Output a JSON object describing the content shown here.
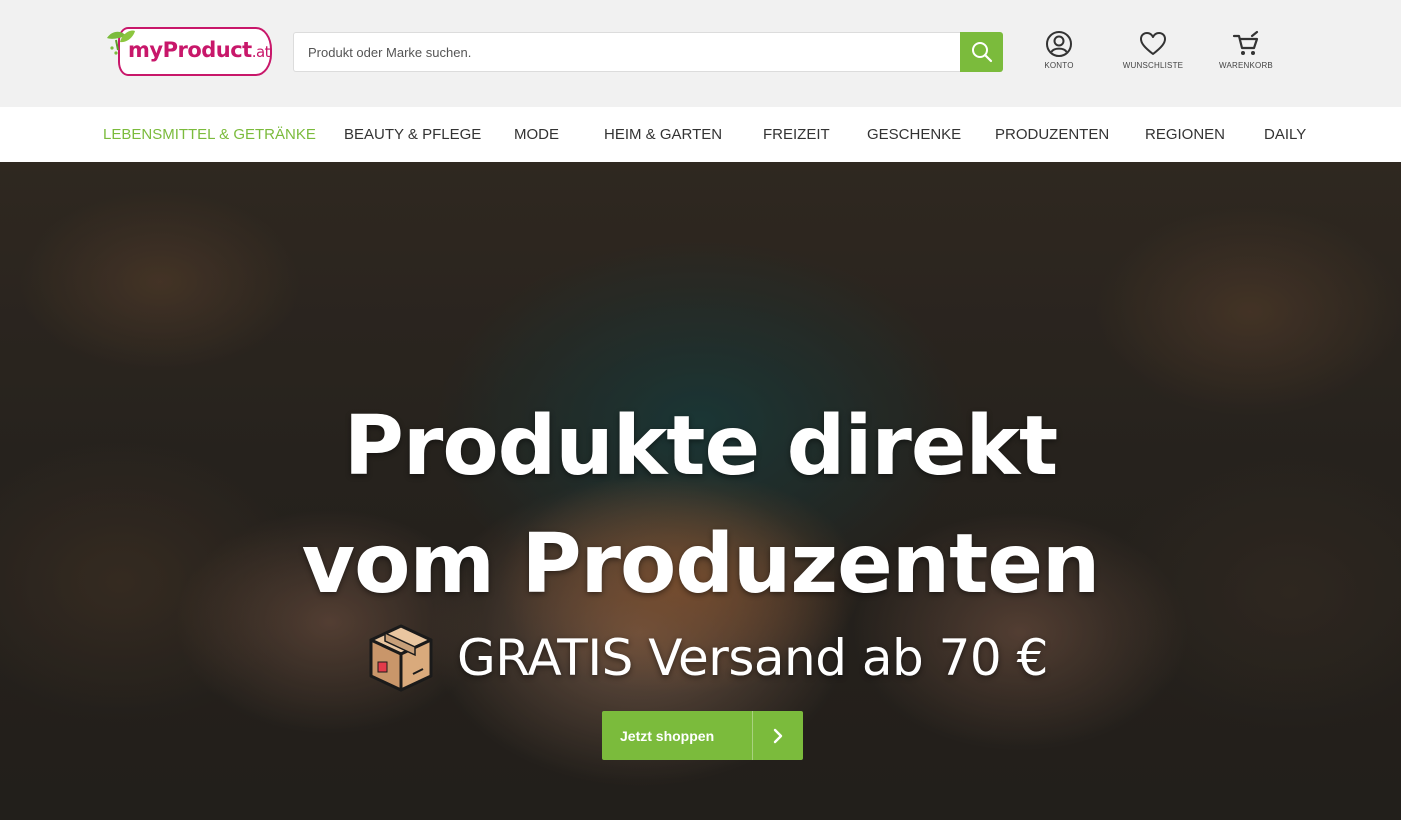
{
  "header": {
    "logo": {
      "text_main": "myProduct",
      "text_tld": ".at",
      "brand_color": "#c8176a",
      "leaf_color": "#7bbb3c"
    },
    "search": {
      "placeholder": "Produkt oder Marke suchen.",
      "value": "",
      "icon": "search-icon"
    },
    "actions": [
      {
        "label": "KONTO",
        "icon": "user-icon"
      },
      {
        "label": "WUNSCHLISTE",
        "icon": "heart-icon"
      },
      {
        "label": "WARENKORB",
        "icon": "cart-icon"
      }
    ]
  },
  "nav": {
    "active_color": "#7bbb3c",
    "items": [
      {
        "label": "LEBENSMITTEL & GETRÄNKE",
        "active": true
      },
      {
        "label": "BEAUTY & PFLEGE",
        "active": false
      },
      {
        "label": "MODE",
        "active": false
      },
      {
        "label": "HEIM & GARTEN",
        "active": false
      },
      {
        "label": "FREIZEIT",
        "active": false
      },
      {
        "label": "GESCHENKE",
        "active": false
      },
      {
        "label": "PRODUZENTEN",
        "active": false
      },
      {
        "label": "REGIONEN",
        "active": false
      },
      {
        "label": "DAILY",
        "active": false
      }
    ]
  },
  "hero": {
    "title_line1": "Produkte direkt",
    "title_line2": "vom Produzenten",
    "subtitle": "GRATIS Versand ab 70 €",
    "subtitle_icon": "package-box-icon",
    "cta": {
      "label": "Jetzt shoppen",
      "icon": "chevron-right-icon",
      "color": "#7bbb3c"
    }
  }
}
